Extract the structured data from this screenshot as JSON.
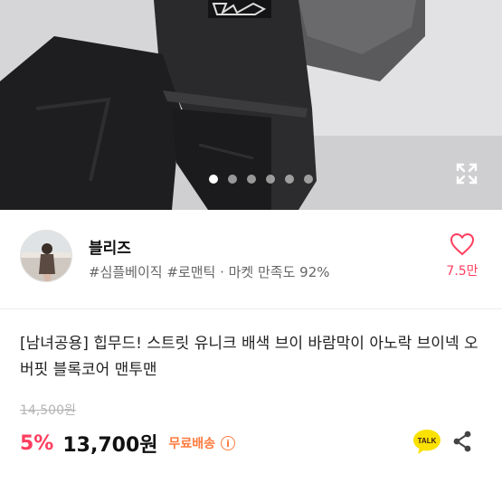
{
  "gallery": {
    "image_alt": "product photo - black windbreaker jacket and pants",
    "slide_count": 6,
    "active_index": 0
  },
  "seller": {
    "name": "블리즈",
    "tags": "#심플베이직 #로맨틱 · 마켓 만족도 92%",
    "like_count": "7.5만"
  },
  "product": {
    "title": "[남녀공용] 힙무드! 스트릿 유니크 배색 브이 바람막이 아노락 브이넥 오버핏 블록코어 맨투맨",
    "original_price": "14,500원",
    "discount": "5%",
    "price": "13,700원",
    "shipping": "무료배송",
    "info_icon": "i"
  },
  "actions": {
    "talk_label": "TALK"
  },
  "colors": {
    "accent_pink": "#ff3e5f",
    "shipping_orange": "#ff7a3d",
    "kakao_yellow": "#fae100"
  }
}
